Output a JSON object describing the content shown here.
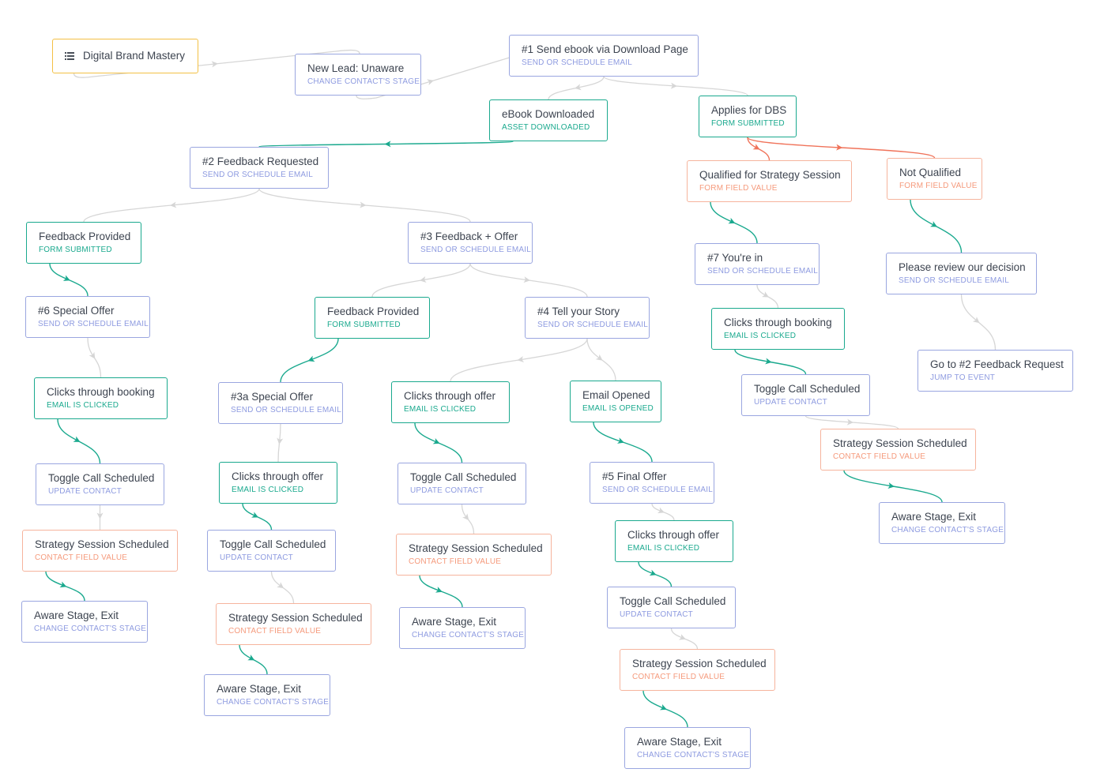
{
  "colors": {
    "action": "#9aa6e0",
    "trigger": "#1aa98e",
    "condition": "#f6b49d",
    "start": "#f3c045",
    "edge_default": "#d6d6d6",
    "edge_yes": "#1aa98e",
    "edge_condition": "#f0735a"
  },
  "campaign": {
    "title": "Digital Brand Mastery",
    "icon": "list-icon"
  },
  "nodes": [
    {
      "id": "n1",
      "title": "New Lead: Unaware",
      "type": "CHANGE CONTACT'S STAGE",
      "kind": "action"
    },
    {
      "id": "n2",
      "title": "#1 Send ebook via Download Page",
      "type": "SEND OR SCHEDULE EMAIL",
      "kind": "action"
    },
    {
      "id": "n3",
      "title": "eBook Downloaded",
      "type": "ASSET DOWNLOADED",
      "kind": "trigger"
    },
    {
      "id": "n4",
      "title": "Applies for DBS",
      "type": "FORM SUBMITTED",
      "kind": "trigger"
    },
    {
      "id": "n5",
      "title": "#2 Feedback Requested",
      "type": "SEND OR SCHEDULE EMAIL",
      "kind": "action"
    },
    {
      "id": "n6",
      "title": "Qualified for Strategy Session",
      "type": "FORM FIELD VALUE",
      "kind": "condition"
    },
    {
      "id": "n7",
      "title": "Not Qualified",
      "type": "FORM FIELD VALUE",
      "kind": "condition"
    },
    {
      "id": "n8",
      "title": "Feedback Provided",
      "type": "FORM SUBMITTED",
      "kind": "trigger"
    },
    {
      "id": "n9",
      "title": "#3 Feedback + Offer",
      "type": "SEND OR SCHEDULE EMAIL",
      "kind": "action"
    },
    {
      "id": "n10",
      "title": "#7 You're in",
      "type": "SEND OR SCHEDULE EMAIL",
      "kind": "action"
    },
    {
      "id": "n11",
      "title": "Please review our decision",
      "type": "SEND OR SCHEDULE EMAIL",
      "kind": "action"
    },
    {
      "id": "n12",
      "title": "#6 Special Offer",
      "type": "SEND OR SCHEDULE EMAIL",
      "kind": "action"
    },
    {
      "id": "n13",
      "title": "Feedback Provided",
      "type": "FORM SUBMITTED",
      "kind": "trigger"
    },
    {
      "id": "n14",
      "title": "#4 Tell your Story",
      "type": "SEND OR SCHEDULE EMAIL",
      "kind": "action"
    },
    {
      "id": "n15",
      "title": "Clicks through booking",
      "type": "EMAIL IS CLICKED",
      "kind": "trigger"
    },
    {
      "id": "n16",
      "title": "Go to #2 Feedback Request",
      "type": "JUMP TO EVENT",
      "kind": "action"
    },
    {
      "id": "n17",
      "title": "Clicks through booking",
      "type": "EMAIL IS CLICKED",
      "kind": "trigger"
    },
    {
      "id": "n18",
      "title": "#3a Special Offer",
      "type": "SEND OR SCHEDULE EMAIL",
      "kind": "action"
    },
    {
      "id": "n19",
      "title": "Clicks through offer",
      "type": "EMAIL IS CLICKED",
      "kind": "trigger"
    },
    {
      "id": "n20",
      "title": "Email Opened",
      "type": "EMAIL IS OPENED",
      "kind": "trigger"
    },
    {
      "id": "n21",
      "title": "Toggle Call Scheduled",
      "type": "UPDATE CONTACT",
      "kind": "action"
    },
    {
      "id": "n22",
      "title": "Strategy Session Scheduled",
      "type": "CONTACT FIELD VALUE",
      "kind": "condition"
    },
    {
      "id": "n23",
      "title": "Toggle Call Scheduled",
      "type": "UPDATE CONTACT",
      "kind": "action"
    },
    {
      "id": "n24",
      "title": "Clicks through offer",
      "type": "EMAIL IS CLICKED",
      "kind": "trigger"
    },
    {
      "id": "n25",
      "title": "Toggle Call Scheduled",
      "type": "UPDATE CONTACT",
      "kind": "action"
    },
    {
      "id": "n26",
      "title": "#5 Final Offer",
      "type": "SEND OR SCHEDULE EMAIL",
      "kind": "action"
    },
    {
      "id": "n27",
      "title": "Aware Stage, Exit",
      "type": "CHANGE CONTACT'S STAGE",
      "kind": "action"
    },
    {
      "id": "n28",
      "title": "Strategy Session Scheduled",
      "type": "CONTACT FIELD VALUE",
      "kind": "condition"
    },
    {
      "id": "n29",
      "title": "Toggle Call Scheduled",
      "type": "UPDATE CONTACT",
      "kind": "action"
    },
    {
      "id": "n30",
      "title": "Strategy Session Scheduled",
      "type": "CONTACT FIELD VALUE",
      "kind": "condition"
    },
    {
      "id": "n31",
      "title": "Clicks through offer",
      "type": "EMAIL IS CLICKED",
      "kind": "trigger"
    },
    {
      "id": "n32",
      "title": "Aware Stage, Exit",
      "type": "CHANGE CONTACT'S STAGE",
      "kind": "action"
    },
    {
      "id": "n33",
      "title": "Toggle Call Scheduled",
      "type": "UPDATE CONTACT",
      "kind": "action"
    },
    {
      "id": "n34",
      "title": "Strategy Session Scheduled",
      "type": "CONTACT FIELD VALUE",
      "kind": "condition"
    },
    {
      "id": "n35",
      "title": "Aware Stage, Exit",
      "type": "CHANGE CONTACT'S STAGE",
      "kind": "action"
    },
    {
      "id": "n36",
      "title": "Strategy Session Scheduled",
      "type": "CONTACT FIELD VALUE",
      "kind": "condition"
    },
    {
      "id": "n37",
      "title": "Aware Stage, Exit",
      "type": "CHANGE CONTACT'S STAGE",
      "kind": "action"
    },
    {
      "id": "n38",
      "title": "Aware Stage, Exit",
      "type": "CHANGE CONTACT'S STAGE",
      "kind": "action"
    }
  ],
  "edges": [
    {
      "from": "n0",
      "to": "n1",
      "style": "default"
    },
    {
      "from": "n1",
      "to": "n2",
      "style": "default"
    },
    {
      "from": "n2",
      "to": "n3",
      "style": "default"
    },
    {
      "from": "n2",
      "to": "n4",
      "style": "default"
    },
    {
      "from": "n3",
      "to": "n5",
      "style": "yes"
    },
    {
      "from": "n4",
      "to": "n6",
      "style": "condition"
    },
    {
      "from": "n4",
      "to": "n7",
      "style": "condition"
    },
    {
      "from": "n5",
      "to": "n8",
      "style": "default"
    },
    {
      "from": "n5",
      "to": "n9",
      "style": "default"
    },
    {
      "from": "n6",
      "to": "n10",
      "style": "yes"
    },
    {
      "from": "n7",
      "to": "n11",
      "style": "yes"
    },
    {
      "from": "n8",
      "to": "n12",
      "style": "yes"
    },
    {
      "from": "n9",
      "to": "n13",
      "style": "default"
    },
    {
      "from": "n9",
      "to": "n14",
      "style": "default"
    },
    {
      "from": "n10",
      "to": "n15",
      "style": "default"
    },
    {
      "from": "n11",
      "to": "n16",
      "style": "default"
    },
    {
      "from": "n12",
      "to": "n17",
      "style": "default"
    },
    {
      "from": "n13",
      "to": "n18",
      "style": "yes"
    },
    {
      "from": "n14",
      "to": "n19",
      "style": "default"
    },
    {
      "from": "n14",
      "to": "n20",
      "style": "default"
    },
    {
      "from": "n15",
      "to": "n21",
      "style": "yes"
    },
    {
      "from": "n21",
      "to": "n22",
      "style": "default"
    },
    {
      "from": "n17",
      "to": "n23",
      "style": "yes"
    },
    {
      "from": "n18",
      "to": "n24",
      "style": "default"
    },
    {
      "from": "n19",
      "to": "n25",
      "style": "yes"
    },
    {
      "from": "n20",
      "to": "n26",
      "style": "yes"
    },
    {
      "from": "n22",
      "to": "n27",
      "style": "yes"
    },
    {
      "from": "n23",
      "to": "n28",
      "style": "default"
    },
    {
      "from": "n24",
      "to": "n29",
      "style": "yes"
    },
    {
      "from": "n25",
      "to": "n30",
      "style": "default"
    },
    {
      "from": "n26",
      "to": "n31",
      "style": "default"
    },
    {
      "from": "n28",
      "to": "n32",
      "style": "yes"
    },
    {
      "from": "n31",
      "to": "n33",
      "style": "yes"
    },
    {
      "from": "n29",
      "to": "n34",
      "style": "default"
    },
    {
      "from": "n30",
      "to": "n35",
      "style": "yes"
    },
    {
      "from": "n33",
      "to": "n36",
      "style": "default"
    },
    {
      "from": "n34",
      "to": "n37",
      "style": "yes"
    },
    {
      "from": "n36",
      "to": "n38",
      "style": "yes"
    }
  ]
}
